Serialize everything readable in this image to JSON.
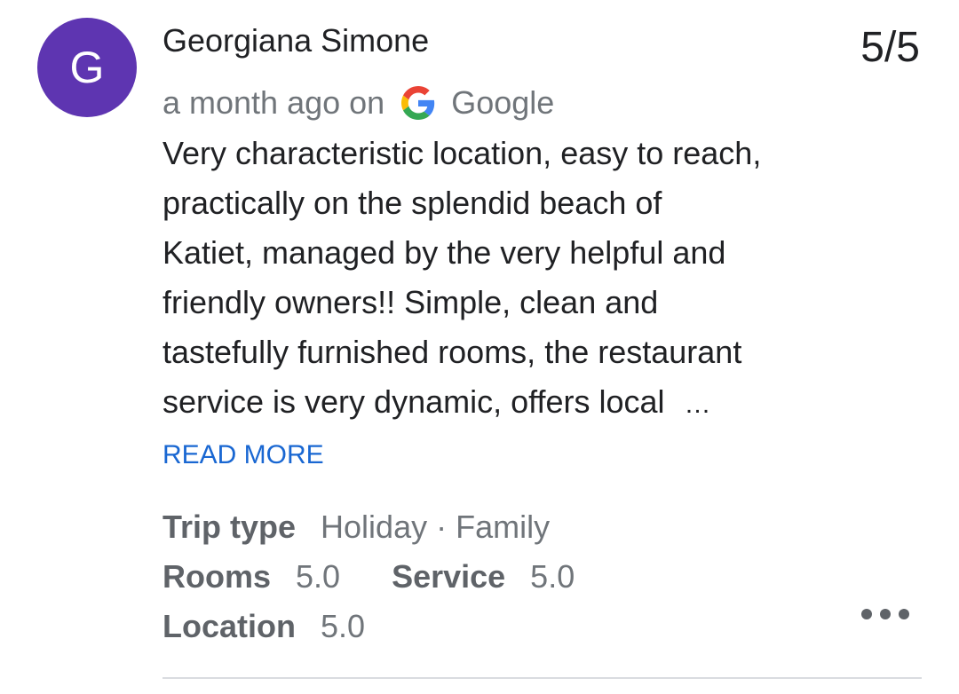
{
  "review": {
    "avatar_letter": "G",
    "avatar_color": "#5e35b1",
    "reviewer_name": "Georgiana Simone",
    "rating": "5/5",
    "time_ago": "a month ago on",
    "source_icon": "google-g-icon",
    "source": "Google",
    "text_lines": [
      "Very characteristic location, easy to reach,",
      "practically on the splendid beach of",
      "Katiet, managed by the very helpful and",
      "friendly owners!! Simple, clean and",
      "tastefully furnished rooms, the restaurant",
      "service is very dynamic, offers local"
    ],
    "truncation": "…",
    "read_more_label": "READ MORE",
    "trip_type_label": "Trip type",
    "trip_type_value": "Holiday · Family",
    "rooms_label": "Rooms",
    "rooms_value": "5.0",
    "service_label": "Service",
    "service_value": "5.0",
    "location_label": "Location",
    "location_value": "5.0",
    "more_icon": "more-horizontal-icon",
    "link_color": "#1967d2"
  }
}
